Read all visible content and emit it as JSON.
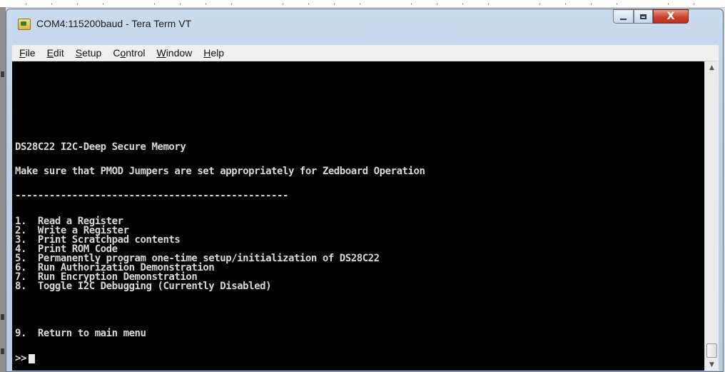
{
  "window": {
    "title": "COM4:115200baud - Tera Term VT",
    "minimize_icon": "minimize-icon",
    "maximize_icon": "maximize-icon",
    "close_glyph": "X"
  },
  "menu": [
    {
      "label": "File",
      "u": "F",
      "rest": "ile"
    },
    {
      "label": "Edit",
      "u": "E",
      "rest": "dit"
    },
    {
      "label": "Setup",
      "u": "S",
      "rest": "etup"
    },
    {
      "label": "Control",
      "pre": "C",
      "u": "o",
      "rest": "ntrol"
    },
    {
      "label": "Window",
      "u": "W",
      "rest": "indow"
    },
    {
      "label": "Help",
      "u": "H",
      "rest": "elp"
    }
  ],
  "terminal": {
    "lines": [
      "DS28C22 I2C-Deep Secure Memory",
      "Make sure that PMOD Jumpers are set appropriately for Zedboard Operation",
      "------------------------------------------------",
      "1.  Read a Register",
      "2.  Write a Register",
      "3.  Print Scratchpad contents",
      "4.  Print ROM Code",
      "5.  Permanently program one-time setup/initialization of DS28C22",
      "6.  Run Authorization Demonstration",
      "7.  Run Encryption Demonstration",
      "8.  Toggle I2C Debugging (Currently Disabled)",
      "9.  Return to main menu"
    ],
    "prompt": ">>"
  },
  "scrollbar": {
    "up_glyph": "▲",
    "down_glyph": "▼"
  }
}
